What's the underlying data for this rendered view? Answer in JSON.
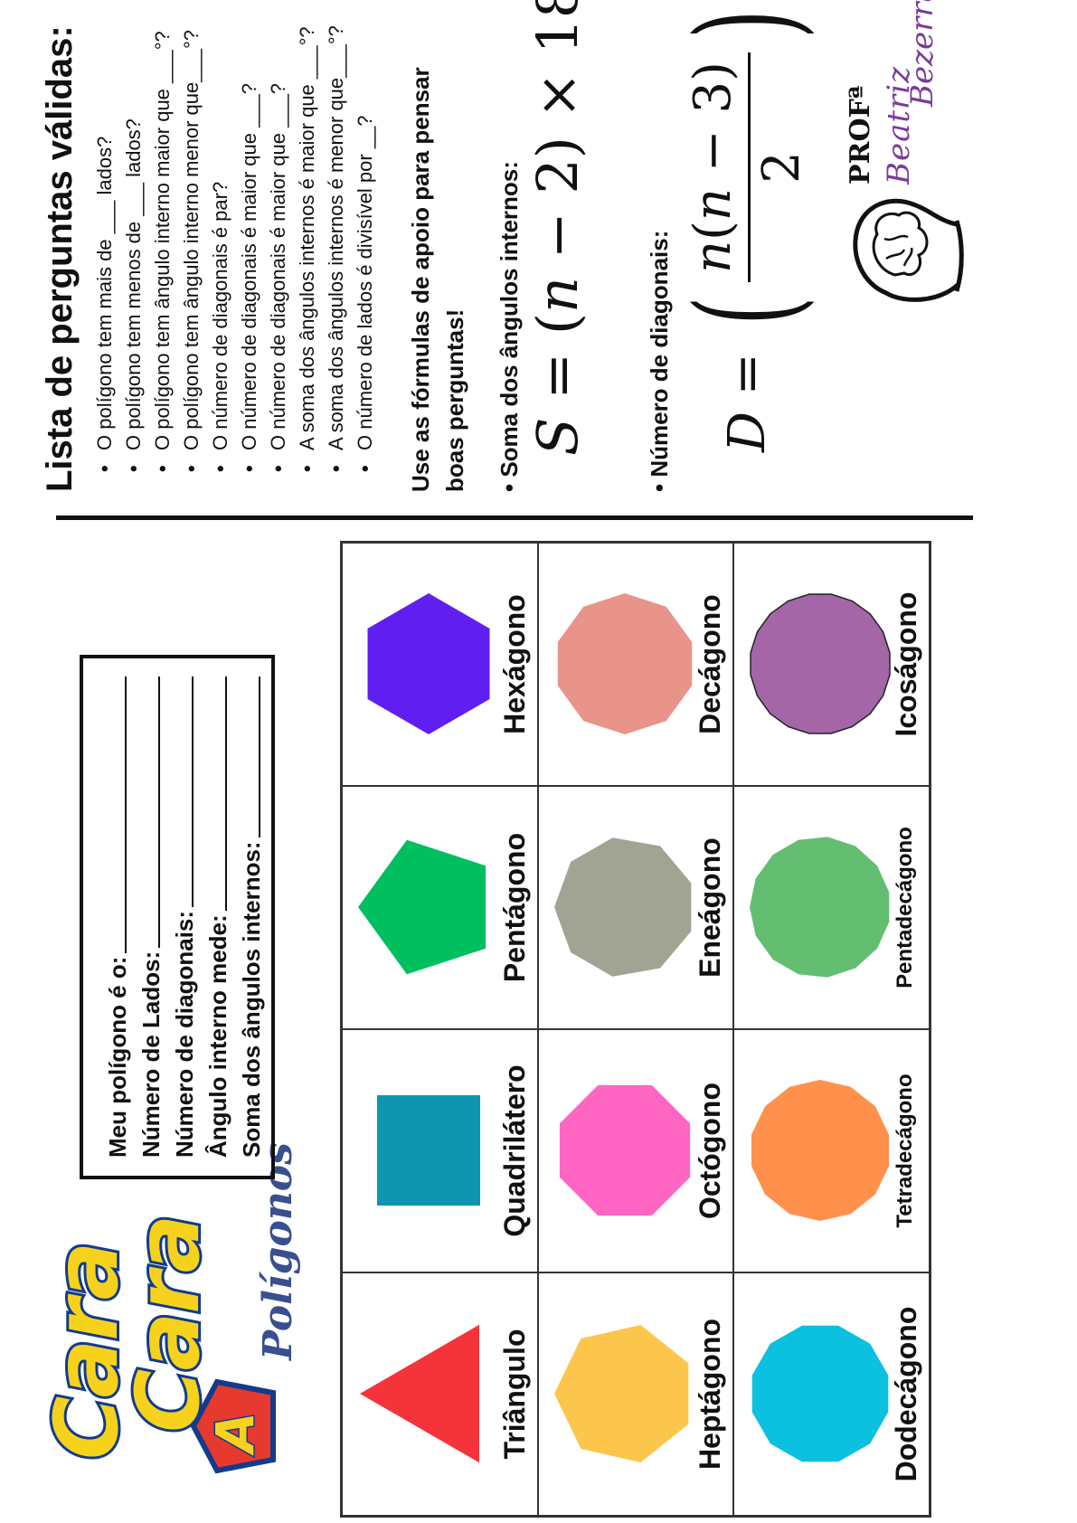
{
  "logo": {
    "word1": "Cara",
    "word2": "Cara",
    "badge": "A",
    "subtitle": "Polígonos"
  },
  "form": {
    "lines": [
      "Meu polígono é o:",
      "Número de Lados:",
      "Número de diagonais:",
      "Ângulo interno mede:",
      "Soma dos ângulos internos:"
    ]
  },
  "polygons": [
    {
      "name": "Triângulo",
      "sides": 3,
      "color": "#f5333a"
    },
    {
      "name": "Quadrilátero",
      "sides": 4,
      "color": "#0f95b0"
    },
    {
      "name": "Pentágono",
      "sides": 5,
      "color": "#00bf5f"
    },
    {
      "name": "Hexágono",
      "sides": 6,
      "color": "#601ff0"
    },
    {
      "name": "Heptágono",
      "sides": 7,
      "color": "#fcc64d"
    },
    {
      "name": "Octógono",
      "sides": 8,
      "color": "#ff66c4"
    },
    {
      "name": "Eneágono",
      "sides": 9,
      "color": "#a1a393"
    },
    {
      "name": "Decágono",
      "sides": 10,
      "color": "#e8948a"
    },
    {
      "name": "Dodecágono",
      "sides": 12,
      "color": "#0cc0df"
    },
    {
      "name": "Tetradecágono",
      "sides": 14,
      "color": "#ff914d"
    },
    {
      "name": "Pentadecágono",
      "sides": 15,
      "color": "#63be72"
    },
    {
      "name": "Icoságono",
      "sides": 20,
      "color": "#a466a7"
    }
  ],
  "questions": {
    "title": "Lista de perguntas válidas:",
    "items": [
      "O polígono tem mais de ___ lados?",
      "O polígono tem menos de ___ lados?",
      "O polígono tem ângulo interno maior que ___°?",
      "O polígono tem ângulo interno menor que___°?",
      "O número de diagonais é par?",
      "O número de diagonais é maior que ___?",
      "O número de diagonais é maior que ___?",
      "A soma dos ângulos internos é maior que ___°?",
      "A soma dos ângulos internos é menor que___°?",
      "O número de lados é divisível por __?"
    ]
  },
  "support": {
    "text": "Use as fórmulas de apoio para pensar boas perguntas!",
    "sum_label": "Soma dos ângulos internos:",
    "diag_label": "Número de diagonais:"
  },
  "branding": {
    "prof": "PROFª",
    "name1": "Beatriz",
    "name2": "Bezerra"
  }
}
